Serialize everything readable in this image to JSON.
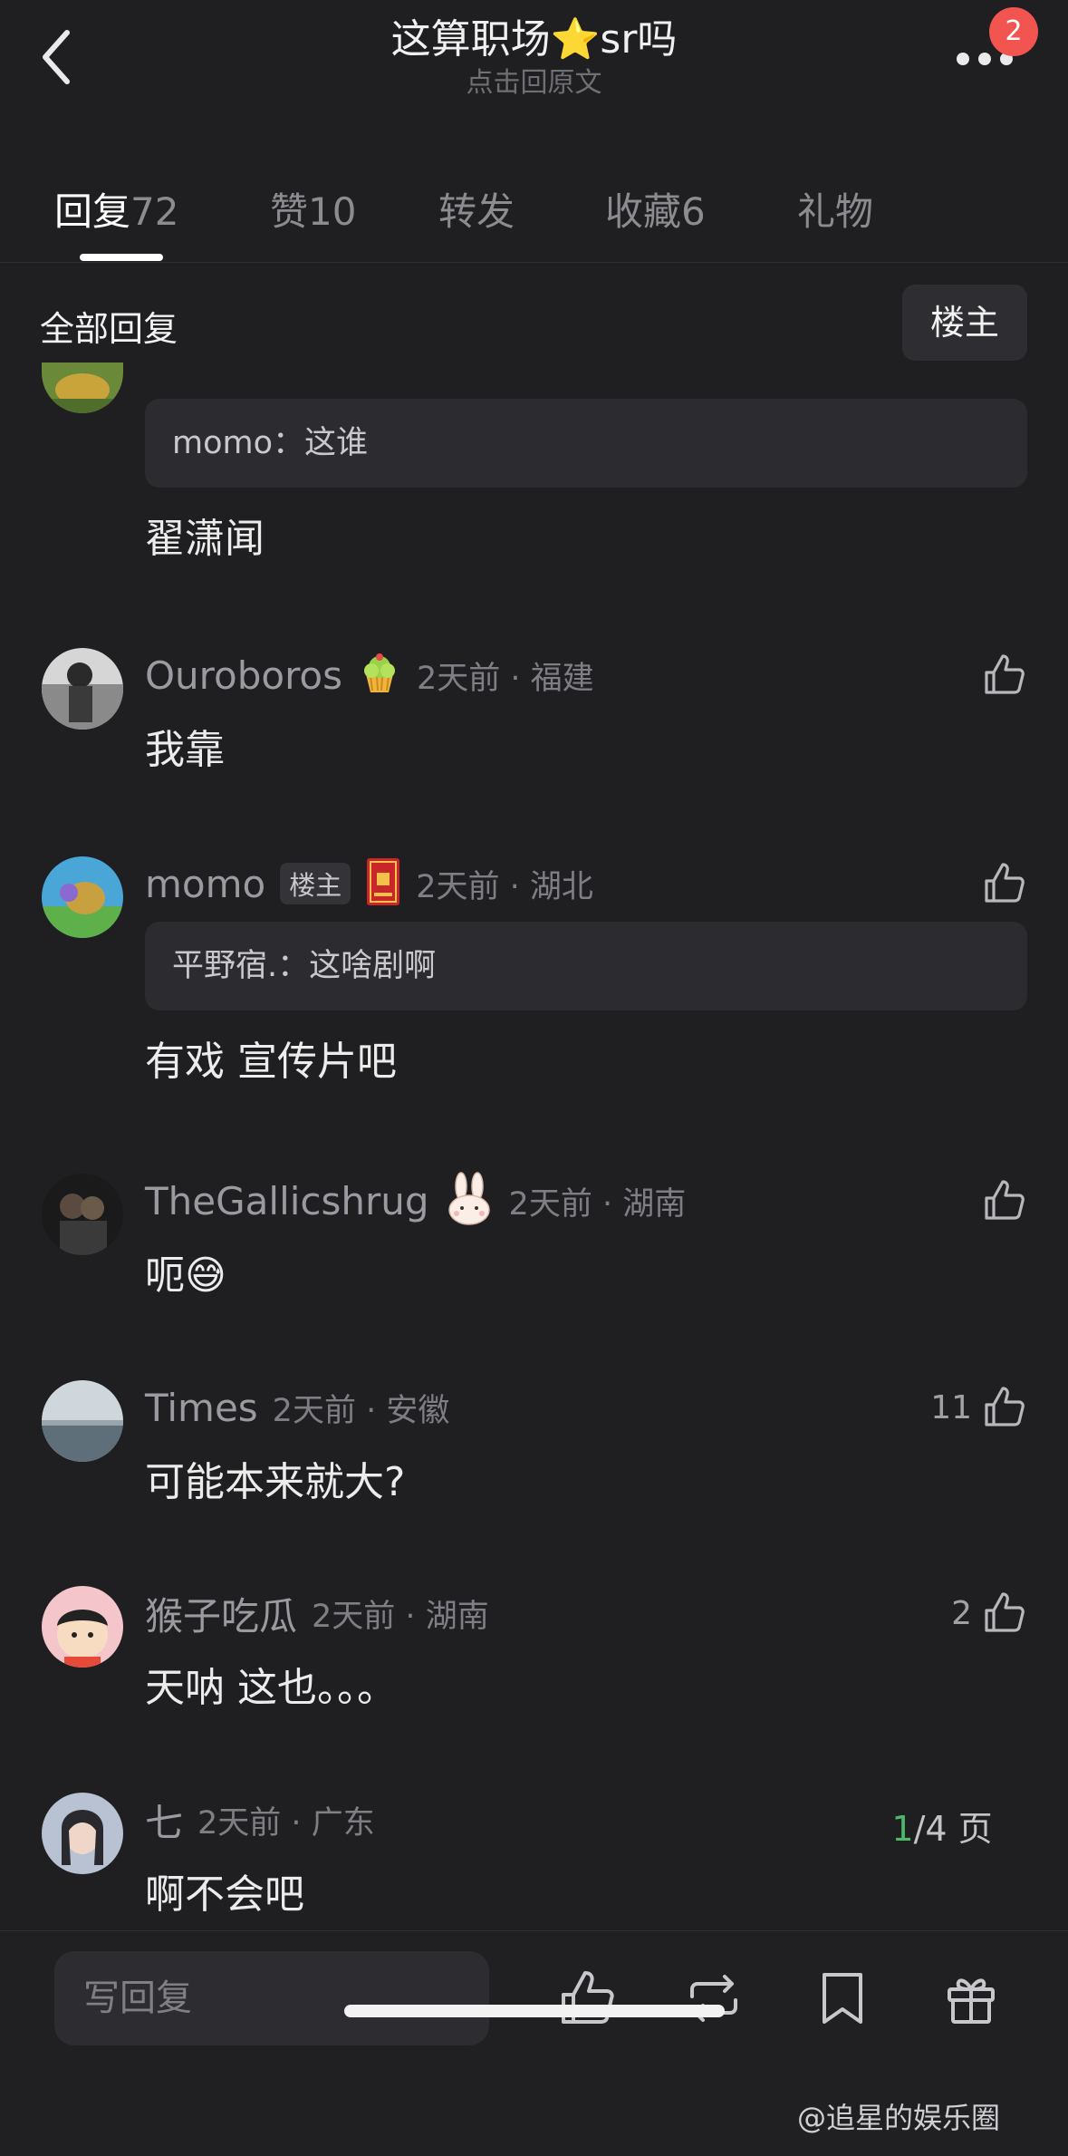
{
  "header": {
    "title": "这算职场",
    "title_star": "⭐",
    "title_suffix": "sr吗",
    "subtitle": "点击回原文",
    "notification_count": "2"
  },
  "tabs": [
    {
      "label": "回复",
      "count": "72",
      "active": true
    },
    {
      "label": "赞",
      "count": "10",
      "active": false
    },
    {
      "label": "转发",
      "count": "",
      "active": false
    },
    {
      "label": "收藏",
      "count": "6",
      "active": false
    },
    {
      "label": "礼物",
      "count": "",
      "active": false
    }
  ],
  "section": {
    "title": "全部回复",
    "owner_filter": "楼主"
  },
  "partial_comment": {
    "quote_user": "momo",
    "quote_sep": "：",
    "quote_text": "这谁",
    "text": "翟潇闻"
  },
  "comments": [
    {
      "user": "Ouroboros",
      "badge_icon": "cupcake-icon",
      "time": "2天前",
      "location": "福建",
      "text": "我靠",
      "likes": ""
    },
    {
      "user": "momo",
      "owner_tag": "楼主",
      "badge_icon": "red-book-icon",
      "time": "2天前",
      "location": "湖北",
      "quote_user": "平野宿.",
      "quote_sep": "：",
      "quote_text": "这啥剧啊",
      "text": "有戏 宣传片吧",
      "likes": ""
    },
    {
      "user": "TheGallicshrug",
      "badge_icon": "bunny-icon",
      "time": "2天前",
      "location": "湖南",
      "text": "呃",
      "text_emoji": "😅",
      "likes": ""
    },
    {
      "user": "Times",
      "time": "2天前",
      "location": "安徽",
      "text": "可能本来就大?",
      "likes": "11"
    },
    {
      "user": "猴子吃瓜",
      "time": "2天前",
      "location": "湖南",
      "text": "天呐 这也。。。",
      "likes": "2"
    },
    {
      "user": "七",
      "time": "2天前",
      "location": "广东",
      "text": "啊不会吧",
      "likes": ""
    }
  ],
  "meta_sep": " · ",
  "pagination": {
    "current": "1",
    "total": "/4 页"
  },
  "bottom_bar": {
    "reply_placeholder": "写回复",
    "icons": [
      "like-icon",
      "repost-icon",
      "bookmark-icon",
      "gift-icon"
    ]
  },
  "watermark": "@追星的娱乐圈",
  "colors": {
    "background": "#1f1f22",
    "accent_green": "#4cb868",
    "badge_red": "#f25450"
  }
}
